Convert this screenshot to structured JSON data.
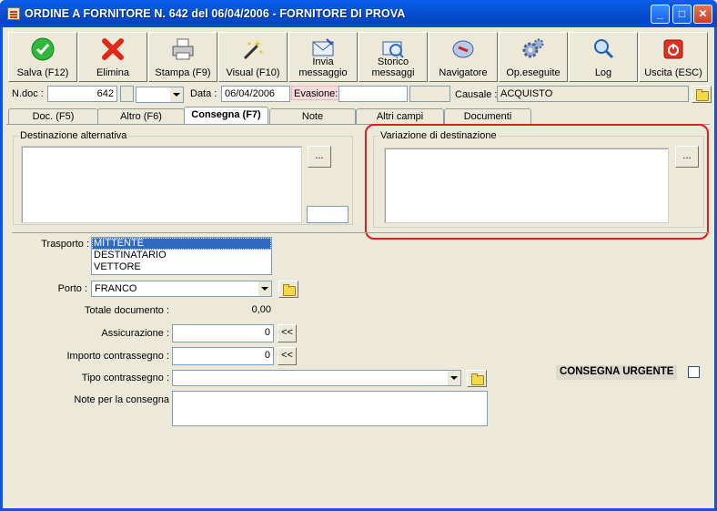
{
  "window": {
    "title": "ORDINE A FORNITORE N.  642  del 06/04/2006 - FORNITORE DI PROVA",
    "controls": {
      "minimize": "_",
      "maximize": "□",
      "close": "✕"
    }
  },
  "toolbar": [
    {
      "label": "Salva (F12)",
      "icon": "check-icon"
    },
    {
      "label": "Elimina",
      "icon": "delete-x-icon"
    },
    {
      "label": "Stampa (F9)",
      "icon": "printer-icon"
    },
    {
      "label": "Visual (F10)",
      "icon": "magic-wand-icon"
    },
    {
      "label": "Invia\nmessaggio",
      "icon": "send-mail-icon"
    },
    {
      "label": "Storico\nmessaggi",
      "icon": "mail-history-icon"
    },
    {
      "label": "Navigatore",
      "icon": "compass-icon"
    },
    {
      "label": "Op.eseguite",
      "icon": "gears-icon"
    },
    {
      "label": "Log",
      "icon": "log-search-icon"
    },
    {
      "label": "Uscita (ESC)",
      "icon": "power-exit-icon"
    }
  ],
  "header": {
    "ndoc_label": "N.doc :",
    "ndoc_value": "642",
    "data_label": "Data :",
    "data_value": "06/04/2006",
    "evasione_label": "Evasione:",
    "evasione_value": "",
    "causale_label": "Causale :",
    "causale_value": "ACQUISTO"
  },
  "tabs": [
    {
      "label": "Doc. (F5)",
      "active": false
    },
    {
      "label": "Altro (F6)",
      "active": false
    },
    {
      "label": "Consegna (F7)",
      "active": true
    },
    {
      "label": "Note",
      "active": false
    },
    {
      "label": "Altri campi",
      "active": false
    },
    {
      "label": "Documenti",
      "active": false
    }
  ],
  "consegna": {
    "dest_alt_title": "Destinazione alternativa",
    "dest_alt_button": "...",
    "variazione_title": "Variazione di destinazione",
    "variazione_button": "...",
    "trasporto_label": "Trasporto :",
    "trasporto_options": [
      "MITTENTE",
      "DESTINATARIO",
      "VETTORE"
    ],
    "trasporto_selected": "MITTENTE",
    "porto_label": "Porto :",
    "porto_value": "FRANCO",
    "totale_label": "Totale documento :",
    "totale_value": "0,00",
    "assicurazione_label": "Assicurazione :",
    "assicurazione_value": "0",
    "assicurazione_button": "<<",
    "importo_label": "Importo contrassegno :",
    "importo_value": "0",
    "importo_button": "<<",
    "tipo_label": "Tipo contrassegno :",
    "tipo_value": "",
    "note_label": "Note per la consegna",
    "urgent_label": "CONSEGNA URGENTE",
    "urgent_checked": false
  },
  "colors": {
    "titlebar": "#0552d6",
    "highlight": "#dd1f24",
    "selection": "#316ac5",
    "evasione_bg": "#fbdcdc"
  }
}
